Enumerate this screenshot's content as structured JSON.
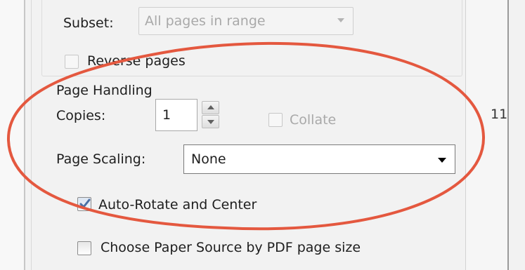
{
  "colors": {
    "annotation": "#e4583f",
    "checkmark": "#4a6fa5"
  },
  "subset": {
    "label": "Subset:",
    "value": "All pages in range",
    "dropdown_icon": "chevron-down-icon"
  },
  "reverse_pages": {
    "label": "Reverse pages",
    "checked": false
  },
  "page_handling": {
    "title": "Page Handling",
    "copies": {
      "label": "Copies:",
      "value": "1"
    },
    "collate": {
      "label": "Collate",
      "checked": false,
      "disabled": true
    },
    "page_scaling": {
      "label": "Page Scaling:",
      "value": "None"
    },
    "auto_rotate": {
      "label": "Auto-Rotate and Center",
      "checked": true
    },
    "choose_paper_source": {
      "label": "Choose Paper Source by PDF page size",
      "checked": false
    }
  },
  "preview": {
    "page_number": "11"
  }
}
